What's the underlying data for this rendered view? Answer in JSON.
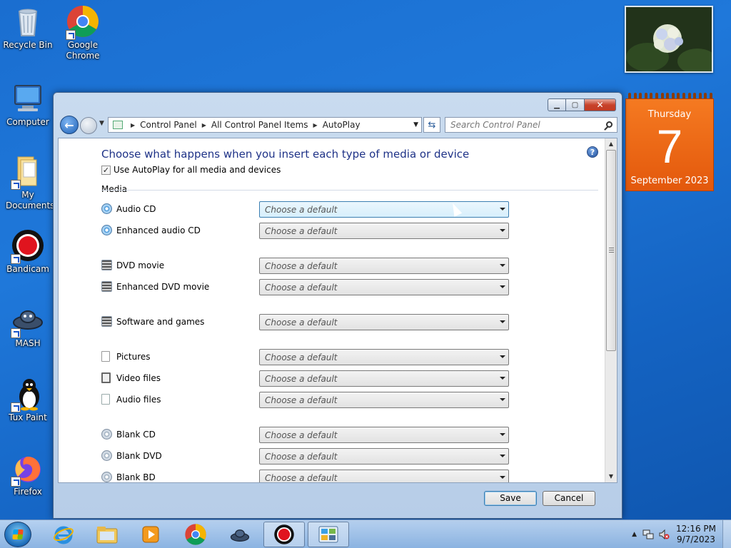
{
  "desktop": {
    "icons": [
      {
        "label": "Recycle Bin"
      },
      {
        "label": "Google Chrome"
      },
      {
        "label": "Computer"
      },
      {
        "label": "My Documents"
      },
      {
        "label": "Bandicam"
      },
      {
        "label": "MASH"
      },
      {
        "label": "Tux Paint"
      },
      {
        "label": "Firefox"
      }
    ]
  },
  "calendar": {
    "weekday": "Thursday",
    "day": "7",
    "month_year": "September 2023"
  },
  "window": {
    "breadcrumb": [
      "Control Panel",
      "All Control Panel Items",
      "AutoPlay"
    ],
    "search_placeholder": "Search Control Panel",
    "title": "Choose what happens when you insert each type of media or device",
    "autoplay_checkbox_label": "Use AutoPlay for all media and devices",
    "autoplay_checked": true,
    "section_label": "Media",
    "dropdown_placeholder": "Choose a default",
    "media_items": [
      {
        "label": "Audio CD",
        "icon": "audio-cd-icon"
      },
      {
        "label": "Enhanced audio CD",
        "icon": "enhanced-audio-cd-icon"
      },
      {
        "label": "DVD movie",
        "icon": "dvd-movie-icon"
      },
      {
        "label": "Enhanced DVD movie",
        "icon": "enhanced-dvd-icon"
      },
      {
        "label": "Software and games",
        "icon": "software-games-icon"
      },
      {
        "label": "Pictures",
        "icon": "pictures-icon"
      },
      {
        "label": "Video files",
        "icon": "video-files-icon"
      },
      {
        "label": "Audio files",
        "icon": "audio-files-icon"
      },
      {
        "label": "Blank CD",
        "icon": "blank-cd-icon"
      },
      {
        "label": "Blank DVD",
        "icon": "blank-dvd-icon"
      },
      {
        "label": "Blank BD",
        "icon": "blank-bd-icon"
      }
    ],
    "save_label": "Save",
    "cancel_label": "Cancel"
  },
  "taskbar": {
    "time": "12:16 PM",
    "date": "9/7/2023"
  }
}
